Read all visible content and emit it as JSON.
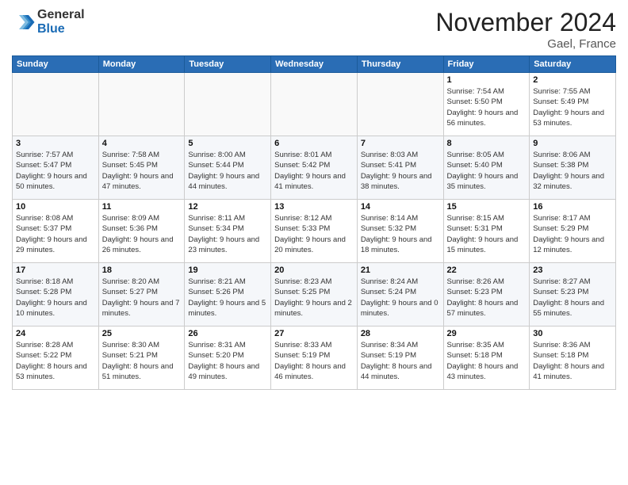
{
  "logo": {
    "line1": "General",
    "line2": "Blue"
  },
  "title": "November 2024",
  "location": "Gael, France",
  "days_of_week": [
    "Sunday",
    "Monday",
    "Tuesday",
    "Wednesday",
    "Thursday",
    "Friday",
    "Saturday"
  ],
  "weeks": [
    [
      {
        "day": "",
        "info": ""
      },
      {
        "day": "",
        "info": ""
      },
      {
        "day": "",
        "info": ""
      },
      {
        "day": "",
        "info": ""
      },
      {
        "day": "",
        "info": ""
      },
      {
        "day": "1",
        "info": "Sunrise: 7:54 AM\nSunset: 5:50 PM\nDaylight: 9 hours and 56 minutes."
      },
      {
        "day": "2",
        "info": "Sunrise: 7:55 AM\nSunset: 5:49 PM\nDaylight: 9 hours and 53 minutes."
      }
    ],
    [
      {
        "day": "3",
        "info": "Sunrise: 7:57 AM\nSunset: 5:47 PM\nDaylight: 9 hours and 50 minutes."
      },
      {
        "day": "4",
        "info": "Sunrise: 7:58 AM\nSunset: 5:45 PM\nDaylight: 9 hours and 47 minutes."
      },
      {
        "day": "5",
        "info": "Sunrise: 8:00 AM\nSunset: 5:44 PM\nDaylight: 9 hours and 44 minutes."
      },
      {
        "day": "6",
        "info": "Sunrise: 8:01 AM\nSunset: 5:42 PM\nDaylight: 9 hours and 41 minutes."
      },
      {
        "day": "7",
        "info": "Sunrise: 8:03 AM\nSunset: 5:41 PM\nDaylight: 9 hours and 38 minutes."
      },
      {
        "day": "8",
        "info": "Sunrise: 8:05 AM\nSunset: 5:40 PM\nDaylight: 9 hours and 35 minutes."
      },
      {
        "day": "9",
        "info": "Sunrise: 8:06 AM\nSunset: 5:38 PM\nDaylight: 9 hours and 32 minutes."
      }
    ],
    [
      {
        "day": "10",
        "info": "Sunrise: 8:08 AM\nSunset: 5:37 PM\nDaylight: 9 hours and 29 minutes."
      },
      {
        "day": "11",
        "info": "Sunrise: 8:09 AM\nSunset: 5:36 PM\nDaylight: 9 hours and 26 minutes."
      },
      {
        "day": "12",
        "info": "Sunrise: 8:11 AM\nSunset: 5:34 PM\nDaylight: 9 hours and 23 minutes."
      },
      {
        "day": "13",
        "info": "Sunrise: 8:12 AM\nSunset: 5:33 PM\nDaylight: 9 hours and 20 minutes."
      },
      {
        "day": "14",
        "info": "Sunrise: 8:14 AM\nSunset: 5:32 PM\nDaylight: 9 hours and 18 minutes."
      },
      {
        "day": "15",
        "info": "Sunrise: 8:15 AM\nSunset: 5:31 PM\nDaylight: 9 hours and 15 minutes."
      },
      {
        "day": "16",
        "info": "Sunrise: 8:17 AM\nSunset: 5:29 PM\nDaylight: 9 hours and 12 minutes."
      }
    ],
    [
      {
        "day": "17",
        "info": "Sunrise: 8:18 AM\nSunset: 5:28 PM\nDaylight: 9 hours and 10 minutes."
      },
      {
        "day": "18",
        "info": "Sunrise: 8:20 AM\nSunset: 5:27 PM\nDaylight: 9 hours and 7 minutes."
      },
      {
        "day": "19",
        "info": "Sunrise: 8:21 AM\nSunset: 5:26 PM\nDaylight: 9 hours and 5 minutes."
      },
      {
        "day": "20",
        "info": "Sunrise: 8:23 AM\nSunset: 5:25 PM\nDaylight: 9 hours and 2 minutes."
      },
      {
        "day": "21",
        "info": "Sunrise: 8:24 AM\nSunset: 5:24 PM\nDaylight: 9 hours and 0 minutes."
      },
      {
        "day": "22",
        "info": "Sunrise: 8:26 AM\nSunset: 5:23 PM\nDaylight: 8 hours and 57 minutes."
      },
      {
        "day": "23",
        "info": "Sunrise: 8:27 AM\nSunset: 5:23 PM\nDaylight: 8 hours and 55 minutes."
      }
    ],
    [
      {
        "day": "24",
        "info": "Sunrise: 8:28 AM\nSunset: 5:22 PM\nDaylight: 8 hours and 53 minutes."
      },
      {
        "day": "25",
        "info": "Sunrise: 8:30 AM\nSunset: 5:21 PM\nDaylight: 8 hours and 51 minutes."
      },
      {
        "day": "26",
        "info": "Sunrise: 8:31 AM\nSunset: 5:20 PM\nDaylight: 8 hours and 49 minutes."
      },
      {
        "day": "27",
        "info": "Sunrise: 8:33 AM\nSunset: 5:19 PM\nDaylight: 8 hours and 46 minutes."
      },
      {
        "day": "28",
        "info": "Sunrise: 8:34 AM\nSunset: 5:19 PM\nDaylight: 8 hours and 44 minutes."
      },
      {
        "day": "29",
        "info": "Sunrise: 8:35 AM\nSunset: 5:18 PM\nDaylight: 8 hours and 43 minutes."
      },
      {
        "day": "30",
        "info": "Sunrise: 8:36 AM\nSunset: 5:18 PM\nDaylight: 8 hours and 41 minutes."
      }
    ]
  ]
}
